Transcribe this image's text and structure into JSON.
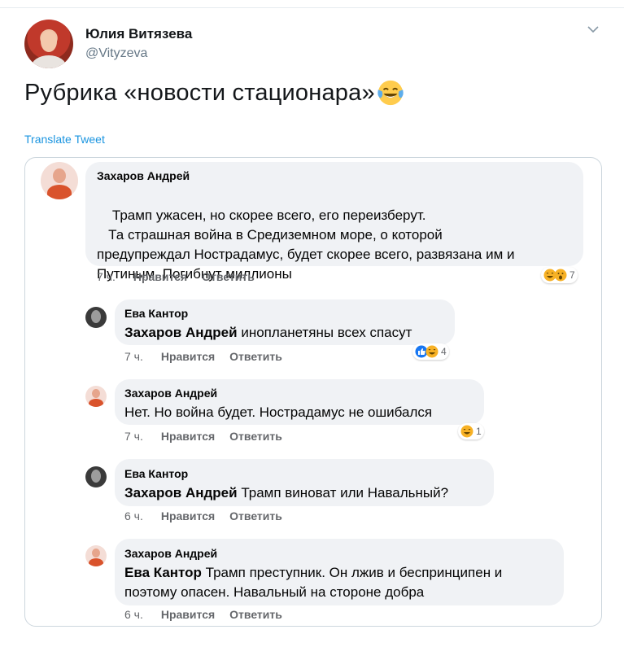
{
  "tweet": {
    "author_name": "Юлия Витязева",
    "author_handle": "@Vityzeva",
    "text": "Рубрика «новости стационара»",
    "translate_label": "Translate Tweet"
  },
  "comments": [
    {
      "author": "Захаров Андрей",
      "mention": "",
      "text": "Трамп ужасен, но скорее всего, его переизберут.\n   Та страшная война в Средиземном море, о которой\nпредупреждал Нострадамус, будет скорее всего, развязана им и\nПутиным. Погибнут миллионы",
      "time": "7 ч.",
      "like": "Нравится",
      "reply": "Ответить",
      "reaction_count": "7"
    },
    {
      "author": "Ева Кантор",
      "mention": "Захаров Андрей",
      "text": " инопланетяны всех спасут",
      "time": "7 ч.",
      "like": "Нравится",
      "reply": "Ответить",
      "reaction_count": "4"
    },
    {
      "author": "Захаров Андрей",
      "mention": "",
      "text": "Нет. Но война будет. Нострадамус не ошибался",
      "time": "7 ч.",
      "like": "Нравится",
      "reply": "Ответить",
      "reaction_count": "1"
    },
    {
      "author": "Ева Кантор",
      "mention": "Захаров Андрей",
      "text": " Трамп виноват или Навальный?",
      "time": "6 ч.",
      "like": "Нравится",
      "reply": "Ответить",
      "reaction_count": ""
    },
    {
      "author": "Захаров Андрей",
      "mention": "Ева Кантор",
      "text": " Трамп преступник. Он лжив и беспринципен и\nпоэтому опасен. Навальный на стороне добра",
      "time": "6 ч.",
      "like": "Нравится",
      "reply": "Ответить",
      "reaction_count": ""
    }
  ],
  "icons": {
    "tweet_emoji": "face-with-tears-of-joy-icon",
    "menu": "chevron-down-icon",
    "reactions": [
      "haha-icon",
      "wow-icon",
      "like-icon"
    ]
  },
  "colors": {
    "link": "#1b95e0",
    "bubble": "#f0f2f5",
    "like_blue": "#1877f2",
    "haha_yellow": "#f7b125"
  }
}
